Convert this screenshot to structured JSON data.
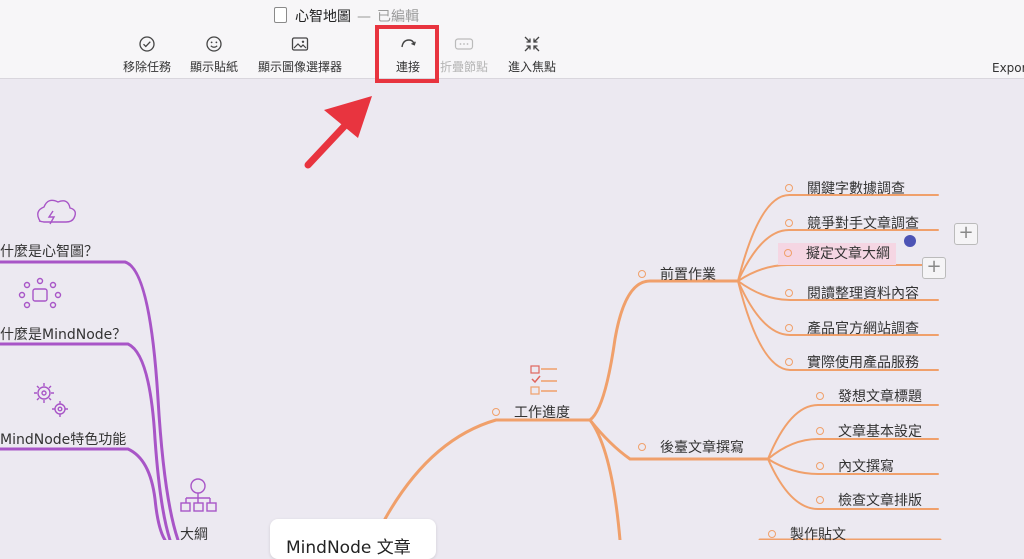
{
  "window": {
    "title": "心智地圖",
    "separator": "—",
    "status": "已編輯"
  },
  "toolbar": {
    "items": [
      {
        "label": "移除任務",
        "icon": "checkmark-circle-icon"
      },
      {
        "label": "顯示貼紙",
        "icon": "smiley-icon"
      },
      {
        "label": "顯示圖像選擇器",
        "icon": "image-icon"
      },
      {
        "label": "連接",
        "icon": "connect-arrow-icon"
      },
      {
        "label": "折疊節點",
        "icon": "fold-node-icon"
      },
      {
        "label": "進入焦點",
        "icon": "focus-icon"
      }
    ],
    "export_label": "Expor"
  },
  "colors": {
    "orange": "#f0a06b",
    "purple": "#a855c7",
    "highlight": "#e8343f",
    "selected_bg": "#f5d6e3",
    "handle": "#4d54b5"
  },
  "mindmap": {
    "root": "MindNode 文章",
    "left_nodes": [
      {
        "label": "什麼是心智圖？",
        "icon": "lightning-cloud-icon"
      },
      {
        "label": "什麼是MindNode？",
        "icon": "network-icon"
      },
      {
        "label": "MindNode特色功能",
        "icon": "gears-icon"
      },
      {
        "label": "大綱",
        "icon": "outline-icon"
      }
    ],
    "work": {
      "label": "工作進度",
      "groups": [
        {
          "label": "前置作業",
          "children": [
            "關鍵字數據調查",
            "競爭對手文章調查",
            "擬定文章大綱",
            "閱讀整理資料內容",
            "產品官方網站調查",
            "實際使用產品服務"
          ]
        },
        {
          "label": "後臺文章撰寫",
          "children": [
            "發想文章標題",
            "文章基本設定",
            "內文撰寫",
            "檢查文章排版"
          ]
        },
        {
          "label": "製作貼文",
          "children": []
        }
      ]
    },
    "selected_node": "擬定文章大綱"
  }
}
